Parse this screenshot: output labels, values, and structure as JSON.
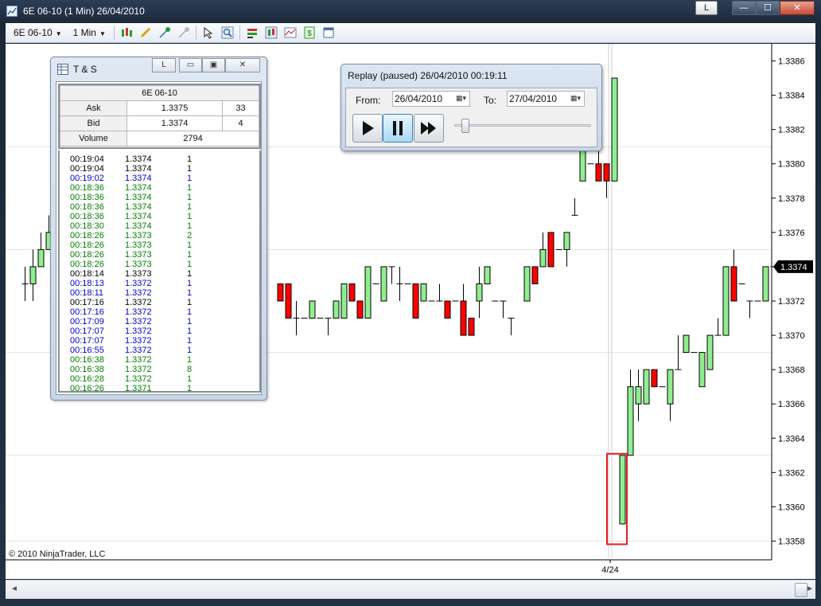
{
  "window": {
    "title": "6E 06-10 (1 Min)  26/04/2010",
    "buttons": {
      "link": "L",
      "minimize": "—",
      "maximize": "☐",
      "close": "✕"
    }
  },
  "toolbar": {
    "instrument": "6E 06-10",
    "interval": "1 Min",
    "icons": [
      "bar-style-icon",
      "pencil-icon",
      "draw-tool-icon",
      "draw-tool-disabled-icon",
      "pointer-icon",
      "zoom-icon",
      "data-box-icon",
      "chart-properties-icon",
      "strategy-icon",
      "dollar-icon",
      "window-icon"
    ]
  },
  "chart": {
    "copyright": "© 2010 NinjaTrader, LLC",
    "date_label": "4/24",
    "current_price": "1.3374",
    "price_labels": [
      "1.3386",
      "1.3384",
      "1.3382",
      "1.3380",
      "1.3378",
      "1.3376",
      "1.3374",
      "1.3372",
      "1.3370",
      "1.3368",
      "1.3366",
      "1.3364",
      "1.3362",
      "1.3360",
      "1.3358"
    ],
    "colors": {
      "up": "#90ee90",
      "down": "#ff0000",
      "outline": "#000000",
      "highlight": "#e02020"
    }
  },
  "chart_data": {
    "type": "candlestick",
    "ylim": [
      1.3357,
      1.3387
    ],
    "ticks": [
      1.3386,
      1.3384,
      1.3382,
      1.338,
      1.3378,
      1.3376,
      1.3374,
      1.3372,
      1.337,
      1.3368,
      1.3366,
      1.3364,
      1.3362,
      1.336,
      1.3358
    ],
    "x_label": "4/24",
    "last_price": 1.3374,
    "candles": [
      {
        "x": 24,
        "o": 1.3373,
        "h": 1.3374,
        "l": 1.3372,
        "c": 1.3373
      },
      {
        "x": 34,
        "o": 1.3373,
        "h": 1.3375,
        "l": 1.3372,
        "c": 1.3374
      },
      {
        "x": 44,
        "o": 1.3374,
        "h": 1.3376,
        "l": 1.3374,
        "c": 1.3375
      },
      {
        "x": 54,
        "o": 1.3375,
        "h": 1.3377,
        "l": 1.3375,
        "c": 1.3376
      },
      {
        "x": 345,
        "o": 1.3373,
        "h": 1.3373,
        "l": 1.3372,
        "c": 1.3372
      },
      {
        "x": 355,
        "o": 1.3373,
        "h": 1.3373,
        "l": 1.3371,
        "c": 1.3371
      },
      {
        "x": 365,
        "o": 1.3371,
        "h": 1.3372,
        "l": 1.337,
        "c": 1.3371
      },
      {
        "x": 375,
        "o": 1.3371,
        "h": 1.3371,
        "l": 1.3371,
        "c": 1.3371
      },
      {
        "x": 385,
        "o": 1.3371,
        "h": 1.3372,
        "l": 1.3371,
        "c": 1.3372
      },
      {
        "x": 395,
        "o": 1.3371,
        "h": 1.3371,
        "l": 1.3371,
        "c": 1.3371
      },
      {
        "x": 405,
        "o": 1.3371,
        "h": 1.3371,
        "l": 1.337,
        "c": 1.3371
      },
      {
        "x": 415,
        "o": 1.3371,
        "h": 1.3372,
        "l": 1.3371,
        "c": 1.3372
      },
      {
        "x": 425,
        "o": 1.3371,
        "h": 1.3373,
        "l": 1.3371,
        "c": 1.3373
      },
      {
        "x": 435,
        "o": 1.3373,
        "h": 1.3373,
        "l": 1.3372,
        "c": 1.3372
      },
      {
        "x": 445,
        "o": 1.3372,
        "h": 1.3372,
        "l": 1.3371,
        "c": 1.3371
      },
      {
        "x": 455,
        "o": 1.3371,
        "h": 1.3374,
        "l": 1.3371,
        "c": 1.3374
      },
      {
        "x": 465,
        "o": 1.3373,
        "h": 1.3373,
        "l": 1.3373,
        "c": 1.3373
      },
      {
        "x": 475,
        "o": 1.3372,
        "h": 1.3374,
        "l": 1.3372,
        "c": 1.3374
      },
      {
        "x": 485,
        "o": 1.3374,
        "h": 1.3374,
        "l": 1.3373,
        "c": 1.3374
      },
      {
        "x": 495,
        "o": 1.3373,
        "h": 1.3374,
        "l": 1.3372,
        "c": 1.3373
      },
      {
        "x": 505,
        "o": 1.3373,
        "h": 1.3373,
        "l": 1.3373,
        "c": 1.3373
      },
      {
        "x": 515,
        "o": 1.3373,
        "h": 1.3373,
        "l": 1.3371,
        "c": 1.3371
      },
      {
        "x": 525,
        "o": 1.3372,
        "h": 1.3373,
        "l": 1.3372,
        "c": 1.3373
      },
      {
        "x": 535,
        "o": 1.3372,
        "h": 1.3372,
        "l": 1.3372,
        "c": 1.3372
      },
      {
        "x": 545,
        "o": 1.3372,
        "h": 1.3373,
        "l": 1.3372,
        "c": 1.3372
      },
      {
        "x": 555,
        "o": 1.3372,
        "h": 1.3372,
        "l": 1.3371,
        "c": 1.3371
      },
      {
        "x": 565,
        "o": 1.3372,
        "h": 1.3372,
        "l": 1.3372,
        "c": 1.3372
      },
      {
        "x": 575,
        "o": 1.3372,
        "h": 1.3373,
        "l": 1.337,
        "c": 1.337
      },
      {
        "x": 585,
        "o": 1.3371,
        "h": 1.3371,
        "l": 1.337,
        "c": 1.337
      },
      {
        "x": 595,
        "o": 1.3372,
        "h": 1.3374,
        "l": 1.3371,
        "c": 1.3373
      },
      {
        "x": 605,
        "o": 1.3373,
        "h": 1.3374,
        "l": 1.3373,
        "c": 1.3374
      },
      {
        "x": 615,
        "o": 1.3372,
        "h": 1.3372,
        "l": 1.3372,
        "c": 1.3372
      },
      {
        "x": 625,
        "o": 1.3372,
        "h": 1.3372,
        "l": 1.3371,
        "c": 1.3372
      },
      {
        "x": 635,
        "o": 1.3371,
        "h": 1.3371,
        "l": 1.337,
        "c": 1.3371
      },
      {
        "x": 655,
        "o": 1.3372,
        "h": 1.3374,
        "l": 1.3372,
        "c": 1.3374
      },
      {
        "x": 665,
        "o": 1.3374,
        "h": 1.3374,
        "l": 1.3373,
        "c": 1.3373
      },
      {
        "x": 675,
        "o": 1.3374,
        "h": 1.3376,
        "l": 1.3374,
        "c": 1.3375
      },
      {
        "x": 685,
        "o": 1.3376,
        "h": 1.3376,
        "l": 1.3374,
        "c": 1.3374
      },
      {
        "x": 695,
        "o": 1.3375,
        "h": 1.3375,
        "l": 1.3375,
        "c": 1.3375
      },
      {
        "x": 705,
        "o": 1.3375,
        "h": 1.3376,
        "l": 1.3374,
        "c": 1.3376
      },
      {
        "x": 715,
        "o": 1.3377,
        "h": 1.3378,
        "l": 1.3377,
        "c": 1.3377
      },
      {
        "x": 725,
        "o": 1.3379,
        "h": 1.3381,
        "l": 1.3379,
        "c": 1.3381
      },
      {
        "x": 735,
        "o": 1.338,
        "h": 1.338,
        "l": 1.338,
        "c": 1.338
      },
      {
        "x": 745,
        "o": 1.338,
        "h": 1.3381,
        "l": 1.3379,
        "c": 1.3379
      },
      {
        "x": 755,
        "o": 1.338,
        "h": 1.338,
        "l": 1.3378,
        "c": 1.3379
      },
      {
        "x": 765,
        "o": 1.3379,
        "h": 1.3385,
        "l": 1.3379,
        "c": 1.3385
      },
      {
        "x": 775,
        "o": 1.3359,
        "h": 1.3363,
        "l": 1.3359,
        "c": 1.3363
      },
      {
        "x": 785,
        "o": 1.3363,
        "h": 1.3368,
        "l": 1.3363,
        "c": 1.3367
      },
      {
        "x": 795,
        "o": 1.3366,
        "h": 1.3368,
        "l": 1.3365,
        "c": 1.3367
      },
      {
        "x": 805,
        "o": 1.3366,
        "h": 1.3368,
        "l": 1.3366,
        "c": 1.3368
      },
      {
        "x": 815,
        "o": 1.3368,
        "h": 1.3368,
        "l": 1.3367,
        "c": 1.3367
      },
      {
        "x": 825,
        "o": 1.3367,
        "h": 1.3367,
        "l": 1.3367,
        "c": 1.3367
      },
      {
        "x": 835,
        "o": 1.3366,
        "h": 1.3368,
        "l": 1.3365,
        "c": 1.3368
      },
      {
        "x": 845,
        "o": 1.3368,
        "h": 1.337,
        "l": 1.3368,
        "c": 1.3368
      },
      {
        "x": 855,
        "o": 1.3369,
        "h": 1.337,
        "l": 1.3369,
        "c": 1.337
      },
      {
        "x": 865,
        "o": 1.3369,
        "h": 1.3369,
        "l": 1.3369,
        "c": 1.3369
      },
      {
        "x": 875,
        "o": 1.3367,
        "h": 1.3369,
        "l": 1.3367,
        "c": 1.3369
      },
      {
        "x": 885,
        "o": 1.3368,
        "h": 1.337,
        "l": 1.3368,
        "c": 1.337
      },
      {
        "x": 895,
        "o": 1.337,
        "h": 1.3371,
        "l": 1.337,
        "c": 1.337
      },
      {
        "x": 905,
        "o": 1.337,
        "h": 1.3374,
        "l": 1.337,
        "c": 1.3374
      },
      {
        "x": 915,
        "o": 1.3374,
        "h": 1.3375,
        "l": 1.3372,
        "c": 1.3372
      },
      {
        "x": 925,
        "o": 1.3373,
        "h": 1.3373,
        "l": 1.3373,
        "c": 1.3373
      },
      {
        "x": 935,
        "o": 1.3372,
        "h": 1.3372,
        "l": 1.3371,
        "c": 1.3372
      },
      {
        "x": 945,
        "o": 1.3372,
        "h": 1.3372,
        "l": 1.3372,
        "c": 1.3372
      },
      {
        "x": 955,
        "o": 1.3372,
        "h": 1.3374,
        "l": 1.3372,
        "c": 1.3374
      },
      {
        "x": 965,
        "o": 1.3374,
        "h": 1.3374,
        "l": 1.3374,
        "c": 1.3374
      }
    ]
  },
  "time_and_sales": {
    "title": "T & S",
    "buttons": {
      "link": "L"
    },
    "instrument": "6E 06-10",
    "ask_label": "Ask",
    "ask_price": "1.3375",
    "ask_size": "33",
    "bid_label": "Bid",
    "bid_price": "1.3374",
    "bid_size": "4",
    "volume_label": "Volume",
    "volume": "2794",
    "colors": {
      "at_ask": "#008000",
      "at_bid": "#0000cc",
      "between": "#000000"
    },
    "trades": [
      {
        "time": "00:19:04",
        "price": "1.3374",
        "size": "1",
        "side": "between"
      },
      {
        "time": "00:19:04",
        "price": "1.3374",
        "size": "1",
        "side": "between"
      },
      {
        "time": "00:19:02",
        "price": "1.3374",
        "size": "1",
        "side": "at_bid"
      },
      {
        "time": "00:18:36",
        "price": "1.3374",
        "size": "1",
        "side": "at_ask"
      },
      {
        "time": "00:18:36",
        "price": "1.3374",
        "size": "1",
        "side": "at_ask"
      },
      {
        "time": "00:18:36",
        "price": "1.3374",
        "size": "1",
        "side": "at_ask"
      },
      {
        "time": "00:18:36",
        "price": "1.3374",
        "size": "1",
        "side": "at_ask"
      },
      {
        "time": "00:18:30",
        "price": "1.3374",
        "size": "1",
        "side": "at_ask"
      },
      {
        "time": "00:18:26",
        "price": "1.3373",
        "size": "2",
        "side": "at_ask"
      },
      {
        "time": "00:18:26",
        "price": "1.3373",
        "size": "1",
        "side": "at_ask"
      },
      {
        "time": "00:18:26",
        "price": "1.3373",
        "size": "1",
        "side": "at_ask"
      },
      {
        "time": "00:18:26",
        "price": "1.3373",
        "size": "1",
        "side": "at_ask"
      },
      {
        "time": "00:18:14",
        "price": "1.3373",
        "size": "1",
        "side": "between"
      },
      {
        "time": "00:18:13",
        "price": "1.3372",
        "size": "1",
        "side": "at_bid"
      },
      {
        "time": "00:18:11",
        "price": "1.3372",
        "size": "1",
        "side": "at_bid"
      },
      {
        "time": "00:17:16",
        "price": "1.3372",
        "size": "1",
        "side": "between"
      },
      {
        "time": "00:17:16",
        "price": "1.3372",
        "size": "1",
        "side": "at_bid"
      },
      {
        "time": "00:17:09",
        "price": "1.3372",
        "size": "1",
        "side": "at_bid"
      },
      {
        "time": "00:17:07",
        "price": "1.3372",
        "size": "1",
        "side": "at_bid"
      },
      {
        "time": "00:17:07",
        "price": "1.3372",
        "size": "1",
        "side": "at_bid"
      },
      {
        "time": "00:16:55",
        "price": "1.3372",
        "size": "1",
        "side": "at_bid"
      },
      {
        "time": "00:16:38",
        "price": "1.3372",
        "size": "1",
        "side": "at_ask"
      },
      {
        "time": "00:16:38",
        "price": "1.3372",
        "size": "8",
        "side": "at_ask"
      },
      {
        "time": "00:16:28",
        "price": "1.3372",
        "size": "1",
        "side": "at_ask"
      },
      {
        "time": "00:16:26",
        "price": "1.3371",
        "size": "1",
        "side": "at_ask"
      }
    ]
  },
  "replay": {
    "title": "Replay (paused) 26/04/2010 00:19:11",
    "from_label": "From:",
    "from_date": "26/04/2010",
    "to_label": "To:",
    "to_date": "27/04/2010",
    "speed_position": 0.05
  }
}
